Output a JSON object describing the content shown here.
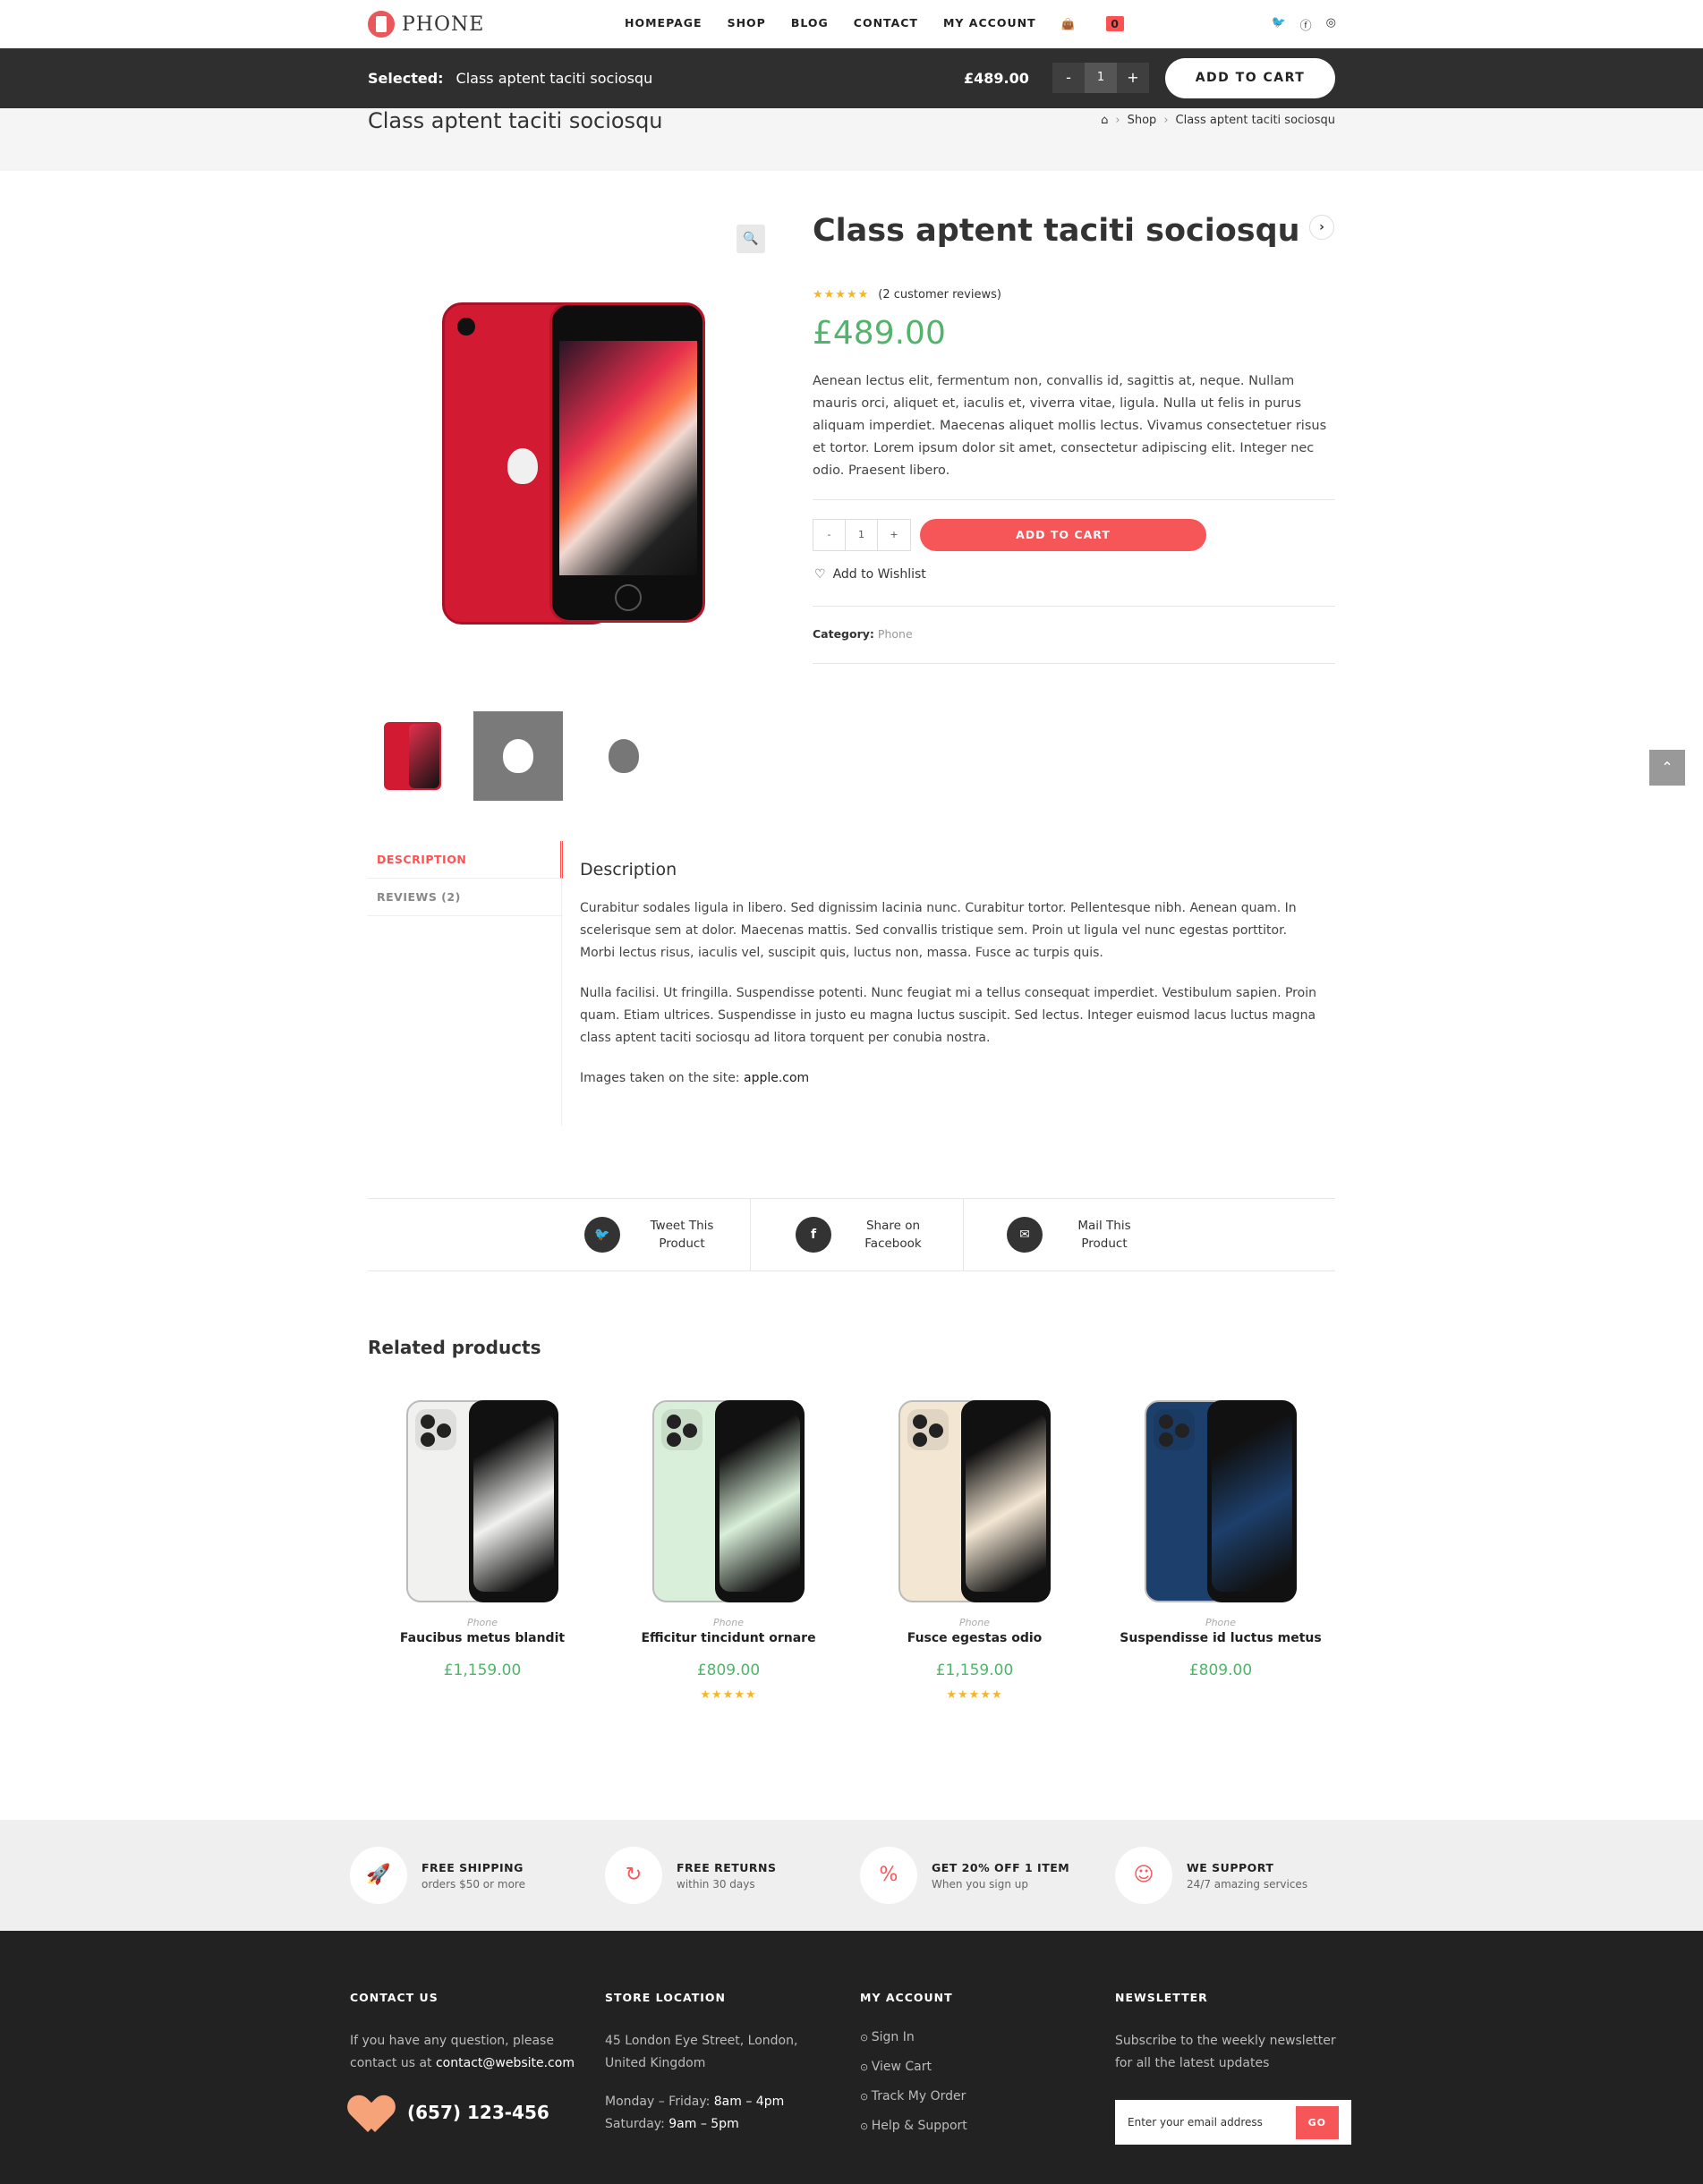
{
  "header": {
    "logo_text": "PHONE",
    "nav": [
      "HOMEPAGE",
      "SHOP",
      "BLOG",
      "CONTACT",
      "MY ACCOUNT"
    ],
    "cart_count": "0",
    "social_icons": [
      "twitter-icon",
      "facebook-icon",
      "instagram-icon"
    ]
  },
  "sticky": {
    "selected_label": "Selected:",
    "product_name": "Class aptent taciti sociosqu",
    "price": "£489.00",
    "minus": "-",
    "qty": "1",
    "plus": "+",
    "add_to_cart": "ADD TO CART"
  },
  "page_header": {
    "title": "Class aptent taciti sociosqu",
    "breadcrumb": [
      "Shop",
      "Class aptent taciti sociosqu"
    ]
  },
  "product": {
    "title": "Class aptent taciti sociosqu",
    "reviews_text": "(2 customer reviews)",
    "rating": 5,
    "price": "£489.00",
    "short_description": "Aenean lectus elit, fermentum non, convallis id, sagittis at, neque. Nullam mauris orci, aliquet et, iaculis et, viverra vitae, ligula. Nulla ut felis in purus aliquam imperdiet. Maecenas aliquet mollis lectus. Vivamus consectetuer risus et tortor. Lorem ipsum dolor sit amet, consectetur adipiscing elit. Integer nec odio. Praesent libero.",
    "qty_minus": "-",
    "qty": "1",
    "qty_plus": "+",
    "add_to_cart": "ADD TO CART",
    "wishlist": "Add to Wishlist",
    "category_label": "Category:",
    "category": "Phone"
  },
  "tabs": {
    "description": "DESCRIPTION",
    "reviews": "REVIEWS (2)"
  },
  "description": {
    "heading": "Description",
    "p1": "Curabitur sodales ligula in libero. Sed dignissim lacinia nunc. Curabitur tortor. Pellentesque nibh. Aenean quam. In scelerisque sem at dolor. Maecenas mattis. Sed convallis tristique sem. Proin ut ligula vel nunc egestas porttitor. Morbi lectus risus, iaculis vel, suscipit quis, luctus non, massa. Fusce ac turpis quis.",
    "p2": "Nulla facilisi. Ut fringilla. Suspendisse potenti. Nunc feugiat mi a tellus consequat imperdiet. Vestibulum sapien. Proin quam. Etiam ultrices. Suspendisse in justo eu magna luctus suscipit. Sed lectus. Integer euismod lacus luctus magna class aptent taciti sociosqu ad litora torquent per conubia nostra.",
    "p3_prefix": "Images taken on the site:",
    "p3_link": "apple.com"
  },
  "share": {
    "tweet": "Tweet This Product",
    "facebook": "Share on Facebook",
    "mail": "Mail This Product"
  },
  "related": {
    "heading": "Related products",
    "items": [
      {
        "category": "Phone",
        "name": "Faucibus metus blandit",
        "price": "£1,159.00",
        "rating": 0,
        "color": "#f1f1ef"
      },
      {
        "category": "Phone",
        "name": "Efficitur tincidunt ornare",
        "price": "£809.00",
        "rating": 5,
        "color": "#d9efd9"
      },
      {
        "category": "Phone",
        "name": "Fusce egestas odio",
        "price": "£1,159.00",
        "rating": 5,
        "color": "#f3e6d3"
      },
      {
        "category": "Phone",
        "name": "Suspendisse id luctus metus",
        "price": "£809.00",
        "rating": 0,
        "color": "#1d3f6b"
      }
    ]
  },
  "features": [
    {
      "title": "FREE SHIPPING",
      "sub": "orders $50 or more",
      "icon": "rocket-icon"
    },
    {
      "title": "FREE RETURNS",
      "sub": "within 30 days",
      "icon": "returns-icon"
    },
    {
      "title": "GET 20% OFF 1 ITEM",
      "sub": "When you sign up",
      "icon": "discount-icon"
    },
    {
      "title": "WE SUPPORT",
      "sub": "24/7 amazing services",
      "icon": "support-icon"
    }
  ],
  "footer": {
    "contact": {
      "heading": "CONTACT US",
      "text": "If you have any question, please contact us at",
      "email": "contact@website.com",
      "phone": "(657) 123-456"
    },
    "store": {
      "heading": "STORE LOCATION",
      "address": "45 London Eye Street, London, United Kingdom",
      "weekday_label": "Monday – Friday:",
      "weekday_hours": "8am – 4pm",
      "sat_label": "Saturday:",
      "sat_hours": "9am – 5pm"
    },
    "account": {
      "heading": "MY ACCOUNT",
      "links": [
        "Sign In",
        "View Cart",
        "Track My Order",
        "Help & Support"
      ]
    },
    "newsletter": {
      "heading": "NEWSLETTER",
      "text": "Subscribe to the weekly newsletter for all the latest updates",
      "placeholder": "Enter your email address",
      "button": "GO"
    }
  },
  "colors": {
    "accent": "#fe5252",
    "price_green": "#52b36a",
    "dark_bar": "#2f2f2f",
    "footer_bg": "#222222",
    "star": "#f5b625"
  }
}
